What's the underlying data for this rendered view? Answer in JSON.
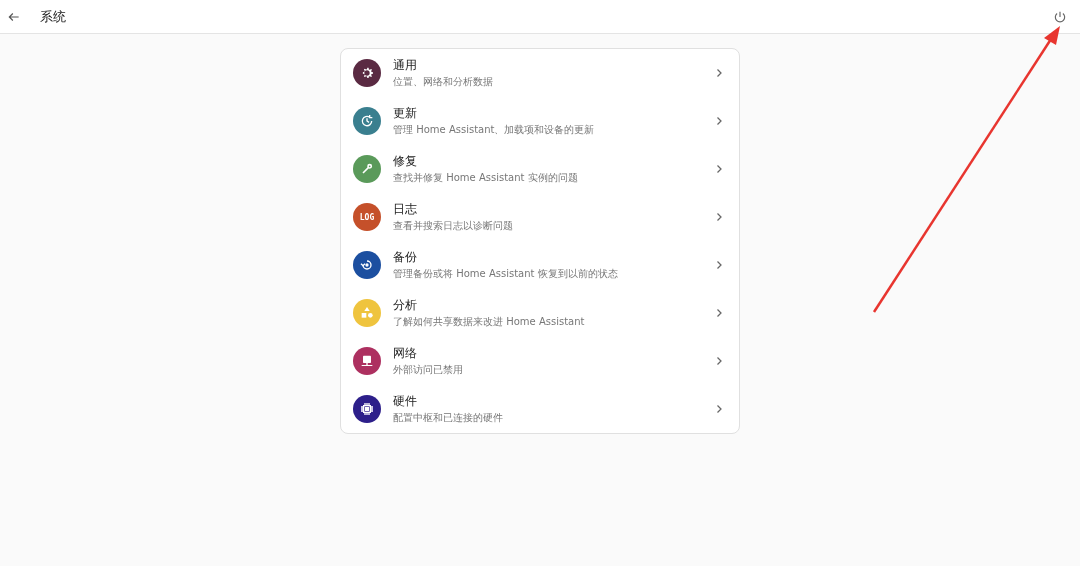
{
  "toolbar": {
    "title": "系统"
  },
  "items": [
    {
      "kind": "settings",
      "color": "#5a2a42",
      "title": "通用",
      "subtitle": "位置、网络和分析数据"
    },
    {
      "kind": "update",
      "color": "#3a7f8f",
      "title": "更新",
      "subtitle": "管理 Home Assistant、加载项和设备的更新"
    },
    {
      "kind": "repair",
      "color": "#5a9a5a",
      "title": "修复",
      "subtitle": "查找并修复 Home Assistant 实例的问题"
    },
    {
      "kind": "log",
      "color": "#c5502a",
      "badge_text": "LOG",
      "title": "日志",
      "subtitle": "查看并搜索日志以诊断问题"
    },
    {
      "kind": "backup",
      "color": "#1c4fa0",
      "title": "备份",
      "subtitle": "管理备份或将 Home Assistant 恢复到以前的状态"
    },
    {
      "kind": "analytics",
      "color": "#efc43e",
      "title": "分析",
      "subtitle": "了解如何共享数据来改进 Home Assistant"
    },
    {
      "kind": "network",
      "color": "#ad3060",
      "title": "网络",
      "subtitle": "外部访问已禁用"
    },
    {
      "kind": "hardware",
      "color": "#2d1f8a",
      "title": "硬件",
      "subtitle": "配置中枢和已连接的硬件"
    }
  ]
}
